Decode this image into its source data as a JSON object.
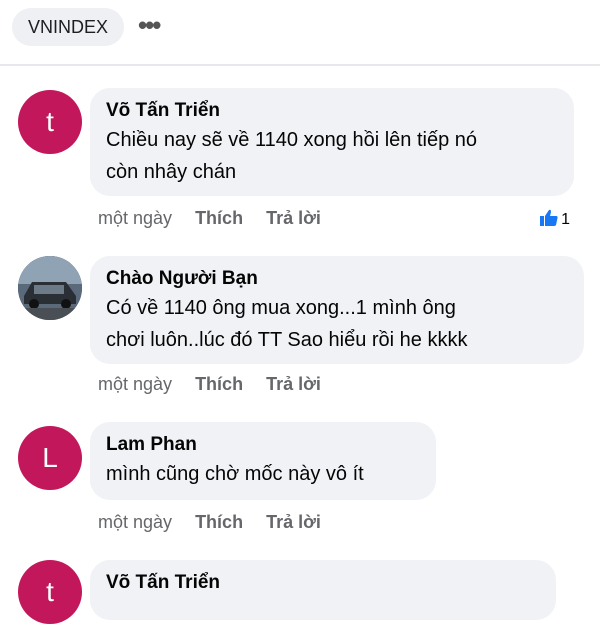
{
  "header": {
    "group_name": "VNINDEX",
    "more_label": "•••"
  },
  "colors": {
    "avatar_accent": "#c2185b",
    "bubble_bg": "#f0f2f5",
    "like_blue": "#1877f2"
  },
  "comments": [
    {
      "author": "Võ Tấn Triển",
      "avatar_letter": "t",
      "text": "Chiều nay sẽ về 1140 xong hồi lên tiếp nó\ncòn nhây chán",
      "time": "một ngày",
      "like_label": "Thích",
      "reply_label": "Trả lời",
      "likes": "1"
    },
    {
      "author": "Chào Người Bạn",
      "avatar_icon": "car-photo-icon",
      "text": "Có về 1140 ông mua xong...1 mình ông\nchơi luôn..lúc đó TT Sao hiểu rồi he kkkk",
      "time": "một ngày",
      "like_label": "Thích",
      "reply_label": "Trả lời"
    },
    {
      "author": "Lam Phan",
      "avatar_letter": "L",
      "text": "mình cũng chờ mốc này vô ít",
      "time": "một ngày",
      "like_label": "Thích",
      "reply_label": "Trả lời"
    },
    {
      "author": "Võ Tấn Triển",
      "avatar_letter": "t"
    }
  ]
}
